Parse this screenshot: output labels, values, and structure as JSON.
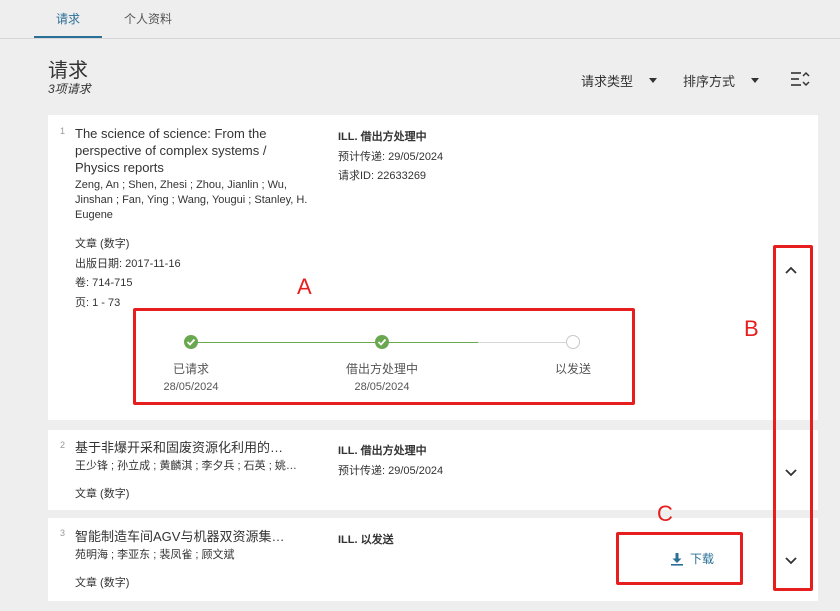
{
  "tabs": [
    {
      "label": "请求"
    },
    {
      "label": "个人资料"
    }
  ],
  "header": {
    "title": "请求",
    "count": "3项请求"
  },
  "filters": {
    "request_type": "请求类型",
    "sort_by": "排序方式"
  },
  "requests": [
    {
      "index": "1",
      "title_lines": [
        "The science of science: From the",
        "perspective of complex systems /",
        "Physics reports"
      ],
      "authors_lines": [
        "Zeng, An ; Shen, Zhesi ; Zhou, Jianlin ; Wu,",
        "Jinshan ; Fan, Ying ; Wang, Yougui ; Stanley, H.",
        "Eugene"
      ],
      "type": "文章 (数字)",
      "pub_date": "出版日期: 2017-11-16",
      "volume": "卷: 714-715",
      "pages": "页: 1 - 73",
      "status": "ILL. 借出方处理中",
      "expected": "预计传递:   29/05/2024",
      "request_id": "请求ID:   22633269",
      "steps": [
        {
          "label": "已请求",
          "date": "28/05/2024",
          "done": true
        },
        {
          "label": "借出方处理中",
          "date": "28/05/2024",
          "done": true
        },
        {
          "label": "以发送",
          "date": "",
          "done": false
        }
      ]
    },
    {
      "index": "2",
      "title": "基于非爆开采和固废资源化利用的…",
      "authors": "王少锋 ; 孙立成 ; 黄麟淇 ; 李夕兵 ; 石英 ; 姚…",
      "type": "文章 (数字)",
      "status": "ILL. 借出方处理中",
      "expected": "预计传递:   29/05/2024"
    },
    {
      "index": "3",
      "title": "智能制造车间AGV与机器双资源集…",
      "authors": "苑明海 ; 李亚东 ; 裴凤雀 ; 顾文斌",
      "type": "文章 (数字)",
      "status": "ILL. 以发送",
      "download": "下载"
    }
  ],
  "annotations": {
    "a": "A",
    "b": "B",
    "c": "C"
  },
  "colors": {
    "accent": "#2a6f97",
    "success": "#6aa84f",
    "annotation": "#e61e1e"
  }
}
